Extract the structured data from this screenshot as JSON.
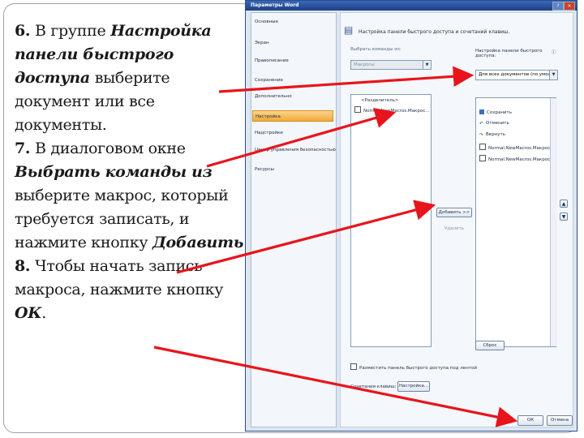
{
  "instructions": {
    "s6_num": "6.",
    "s6_a": " В группе ",
    "s6_b": "Настройка панели быстрого доступа",
    "s6_c": " выберите документ или все документы.",
    "s7_num": "7.",
    "s7_a": " В диалоговом окне ",
    "s7_b": "Выбрать команды из",
    "s7_c": " выберите макрос, который требуется записать, и нажмите кнопку ",
    "s7_d": "Добавить",
    "s7_e": ".",
    "s8_num": "8.",
    "s8_a": " Чтобы начать запись макроса, нажмите кнопку ",
    "s8_b": "ОК",
    "s8_c": "."
  },
  "dialog": {
    "title": "Параметры Word",
    "nav": [
      "Основные",
      "Экран",
      "Правописание",
      "Сохранение",
      "Дополнительно",
      "Настройка",
      "Надстройки",
      "Центр управления безопасностью",
      "Ресурсы"
    ],
    "selected_nav": "Настройка",
    "heading": "Настройка панели быстрого доступа и сочетаний клавиш.",
    "choose_label": "Выбрать команды из:",
    "choose_value": "Макросы",
    "customize_label": "Настройка панели быстрого доступа:",
    "customize_value": "Для всех документов (по умолч...",
    "left_list": [
      "<Разделитель>",
      "Normal.NewMacros.Макрос..."
    ],
    "right_list": [
      "Сохранить",
      "Отменить",
      "Вернуть",
      "Normal.NewMacros.Макрос1",
      "Normal.NewMacros.Макрос"
    ],
    "add_button": "Добавить >>",
    "remove_button": "Удалить",
    "reset_button": "Сброс",
    "checkbox_label": "Разместить панель быстрого доступа под лентой",
    "shortcut_label": "Сочетания клавиш:",
    "shortcut_button": "Настройка...",
    "ok_button": "ОК",
    "cancel_button": "Отмена"
  },
  "colors": {
    "arrow": "#e8141b",
    "selected_nav": "#f0a93a",
    "title_bar": "#1d3f82"
  }
}
